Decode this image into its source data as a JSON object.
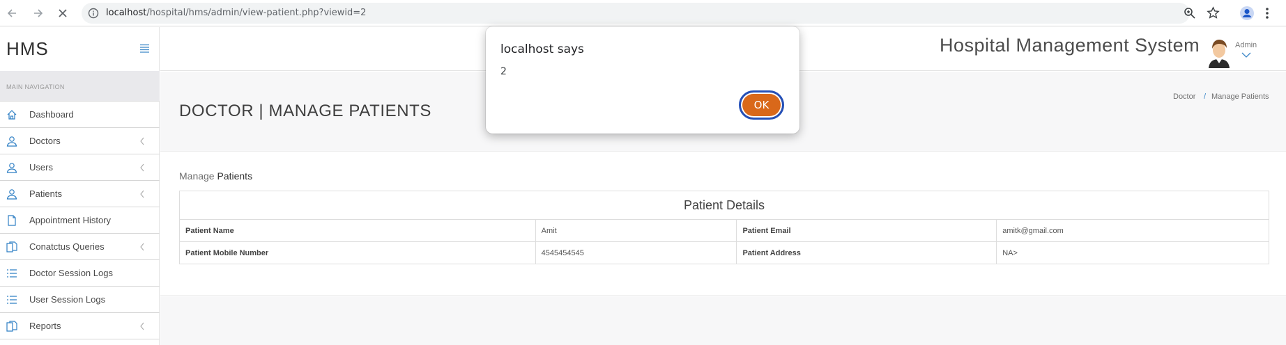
{
  "browser": {
    "url_host": "localhost",
    "url_path": "/hospital/hms/admin/view-patient.php?viewid=2"
  },
  "sidebar": {
    "brand": "HMS",
    "section_header": "MAIN NAVIGATION",
    "items": [
      {
        "label": "Dashboard",
        "icon": "home-icon",
        "has_submenu": false
      },
      {
        "label": "Doctors",
        "icon": "user-icon",
        "has_submenu": true
      },
      {
        "label": "Users",
        "icon": "user-icon",
        "has_submenu": true
      },
      {
        "label": "Patients",
        "icon": "user-icon",
        "has_submenu": true
      },
      {
        "label": "Appointment History",
        "icon": "file-icon",
        "has_submenu": false
      },
      {
        "label": "Conatctus Queries",
        "icon": "files-icon",
        "has_submenu": true
      },
      {
        "label": "Doctor Session Logs",
        "icon": "list-icon",
        "has_submenu": false
      },
      {
        "label": "User Session Logs",
        "icon": "list-icon",
        "has_submenu": false
      },
      {
        "label": "Reports",
        "icon": "files-icon",
        "has_submenu": true
      }
    ]
  },
  "header": {
    "app_title": "Hospital Management System",
    "user_label": "Admin"
  },
  "page": {
    "title": "DOCTOR | MANAGE PATIENTS",
    "breadcrumb": [
      "Doctor",
      "/",
      "Manage Patients"
    ],
    "section_label_prefix": "Manage",
    "section_label_strong": "Patients"
  },
  "details": {
    "caption": "Patient Details",
    "rows": [
      [
        "Patient Name",
        "Amit",
        "Patient Email",
        "amitk@gmail.com"
      ],
      [
        "Patient Mobile Number",
        "4545454545",
        "Patient Address",
        "NA>"
      ]
    ]
  },
  "dialog": {
    "title": "localhost says",
    "message": "2",
    "ok_label": "OK"
  },
  "colors": {
    "accent_blue": "#2f7fc4",
    "ok_button": "#d9681a",
    "focus_ring": "#2450b8"
  }
}
